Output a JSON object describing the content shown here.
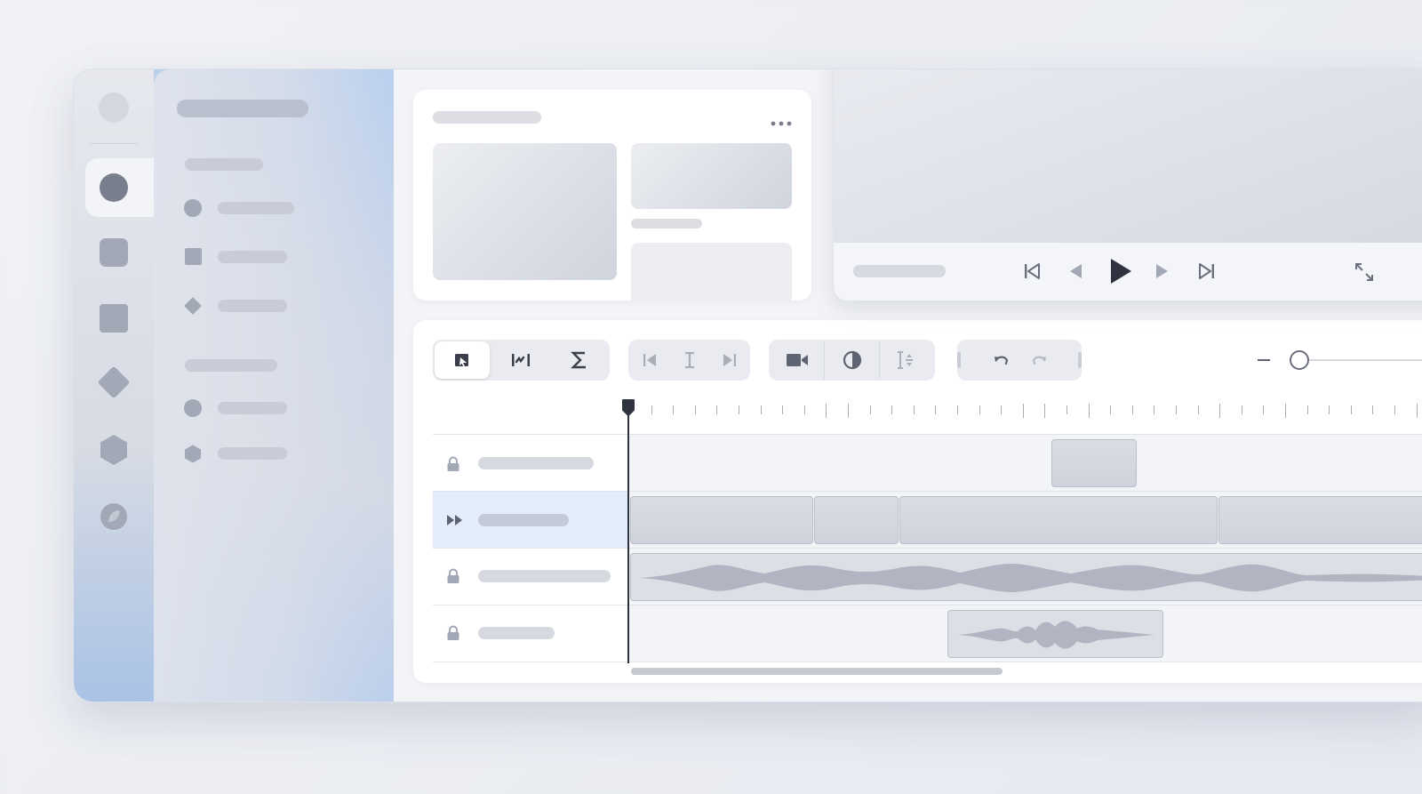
{
  "colors": {
    "accent": "#a8c6ee",
    "selected_track": "#e3ecfb",
    "playhead": "#2f3340",
    "clip": "#d3d7df",
    "icon": "#6a6f7c"
  },
  "rail": {
    "icons": [
      "avatar-icon",
      "circle-icon",
      "rounded-square-icon",
      "square-icon",
      "diamond-icon",
      "hexagon-icon",
      "leaf-icon"
    ],
    "active_index": 1
  },
  "sidebar": {
    "section_1_items": [
      "circle-icon",
      "square-icon",
      "diamond-icon"
    ],
    "section_2_items": [
      "circle-icon",
      "hexagon-icon"
    ]
  },
  "media_card": {
    "menu_icon": "more-horizontal-icon"
  },
  "player": {
    "controls": [
      "skip-to-start-icon",
      "step-back-icon",
      "play-icon",
      "step-forward-icon",
      "skip-to-end-icon"
    ],
    "fullscreen_icon": "fullscreen-icon"
  },
  "toolbar": {
    "group_1": [
      "select-tool-icon",
      "trim-tool-icon",
      "sigma-icon"
    ],
    "group_1_active": 0,
    "group_2": [
      "go-to-in-icon",
      "cursor-icon",
      "go-to-out-icon"
    ],
    "group_3": [
      "camera-icon",
      "contrast-icon",
      "split-icon"
    ],
    "group_4": [
      "undo-icon",
      "redo-icon"
    ],
    "zoom_icon": "zoom-out-icon",
    "zoom_level": 0.05
  },
  "timeline": {
    "playhead_position": 0.0,
    "tracks": [
      {
        "lock_icon": "lock-icon",
        "selected": false,
        "type": "video"
      },
      {
        "lock_icon": "fast-forward-icon",
        "selected": true,
        "type": "video"
      },
      {
        "lock_icon": "lock-icon",
        "selected": false,
        "type": "audio"
      },
      {
        "lock_icon": "lock-icon",
        "selected": false,
        "type": "audio"
      }
    ]
  }
}
